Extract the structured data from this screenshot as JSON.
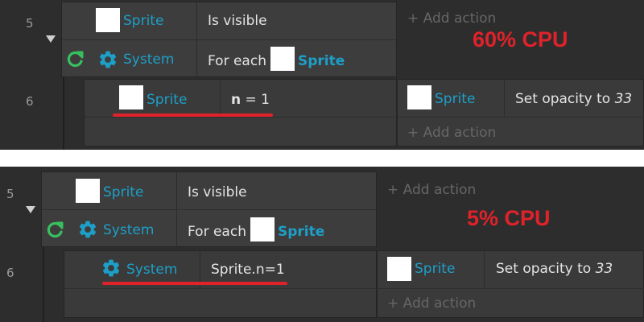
{
  "colors": {
    "object_name": "#1d9fc8",
    "cpu_label": "#e0222a",
    "underline": "#e0222a",
    "loop_icon": "#37c15e",
    "panel_bg": "#2d2d2d",
    "block_bg": "#3d3d3d",
    "separator": "#ffffff"
  },
  "panels": [
    {
      "cpu_label": "60% CPU",
      "events": [
        {
          "number": "5",
          "conditions": [
            {
              "icon": "white-square",
              "object": "Sprite",
              "text": "Is visible"
            },
            {
              "icon": "gear-icon",
              "loop_icon": "loop-icon",
              "object": "System",
              "text_prefix": "For each",
              "text_object": "Sprite"
            }
          ],
          "actions": [
            {
              "label": "Add action"
            }
          ]
        },
        {
          "number": "6",
          "conditions": [
            {
              "icon": "white-square",
              "object": "Sprite",
              "var": "n",
              "op": "=",
              "value": "1"
            }
          ],
          "actions": [
            {
              "icon": "white-square",
              "object": "Sprite",
              "text": "Set opacity to",
              "param": "33"
            },
            {
              "label": "Add action"
            }
          ]
        }
      ]
    },
    {
      "cpu_label": "5% CPU",
      "events": [
        {
          "number": "5",
          "conditions": [
            {
              "icon": "white-square",
              "object": "Sprite",
              "text": "Is visible"
            },
            {
              "icon": "gear-icon",
              "loop_icon": "loop-icon",
              "object": "System",
              "text_prefix": "For each",
              "text_object": "Sprite"
            }
          ],
          "actions": [
            {
              "label": "Add action"
            }
          ]
        },
        {
          "number": "6",
          "conditions": [
            {
              "icon": "gear-icon",
              "object": "System",
              "expression": "Sprite.n=1"
            }
          ],
          "actions": [
            {
              "icon": "white-square",
              "object": "Sprite",
              "text": "Set opacity to",
              "param": "33"
            },
            {
              "label": "Add action"
            }
          ]
        }
      ]
    }
  ]
}
